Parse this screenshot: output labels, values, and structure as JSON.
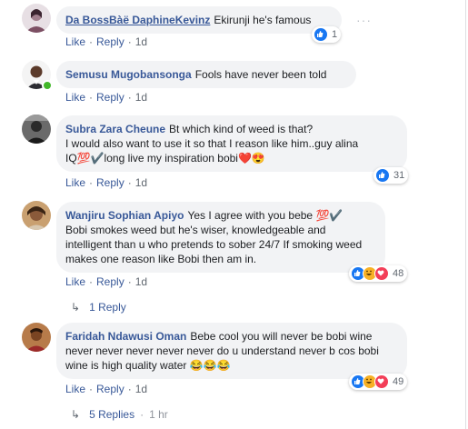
{
  "comments": [
    {
      "author": "Da BossBàë DaphineKevinz",
      "text": "Ekirunji he's famous",
      "like": "Like",
      "reply": "Reply",
      "time": "1d",
      "reactions": "1",
      "more": "···"
    },
    {
      "author": "Semusu Mugobansonga",
      "text": "Fools have never been told",
      "like": "Like",
      "reply": "Reply",
      "time": "1d"
    },
    {
      "author": "Subra Zara Cheune",
      "line1": "Bt which kind of weed is that?",
      "line2": "I would also want to use it so that I reason like him..guy alina",
      "line3": "IQ💯✔️long live my inspiration bobi❤️😍",
      "like": "Like",
      "reply": "Reply",
      "time": "1d",
      "reactions": "31"
    },
    {
      "author": "Wanjiru Sophian Apiyo",
      "line1": "Yes I agree with you bebe 💯✔️",
      "line2": "Bobi smokes weed but he's wiser, knowledgeable and",
      "line3": "intelligent than u who pretends to sober 24/7 If smoking weed",
      "line4": "makes one reason like Bobi then am in.",
      "like": "Like",
      "reply": "Reply",
      "time": "1d",
      "reactions": "48",
      "replies": "1 Reply"
    },
    {
      "author": "Faridah Ndawusi Oman",
      "line1": "Bebe cool you will never be bobi wine",
      "line2": "never never never never never do u understand never b cos bobi",
      "line3": "wine is high quality water 😂😂😂",
      "like": "Like",
      "reply": "Reply",
      "time": "1d",
      "reactions": "49",
      "replies": "5 Replies",
      "replies_time": "1 hr"
    }
  ],
  "colors": {
    "link": "#385898",
    "bubble": "#f2f3f5",
    "meta": "#606770",
    "like_blue": "#1877f2"
  }
}
